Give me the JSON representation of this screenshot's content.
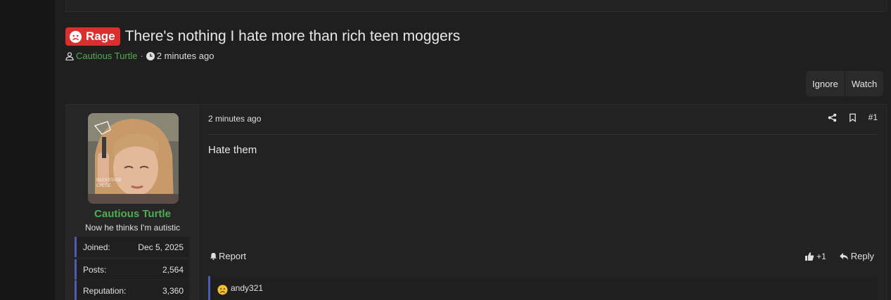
{
  "thread": {
    "prefix": "Rage",
    "title": "There's nothing I hate more than rich teen moggers",
    "author": "Cautious Turtle",
    "meta_separator": "·",
    "time": "2 minutes ago"
  },
  "thread_actions": {
    "ignore": "Ignore",
    "watch": "Watch"
  },
  "post": {
    "time": "2 minutes ago",
    "number": "#1",
    "body": "Hate them",
    "report": "Report",
    "reaction_count": "+1",
    "reply": "Reply",
    "reacted_by": "andy321"
  },
  "user": {
    "name": "Cautious Turtle",
    "title": "Now he thinks I'm autistic",
    "avatar_text": "BACKSTAGE CHLOE",
    "stats": [
      {
        "label": "Joined:",
        "value": "Dec 5, 2025"
      },
      {
        "label": "Posts:",
        "value": "2,564"
      },
      {
        "label": "Reputation:",
        "value": "3,360"
      }
    ]
  },
  "colors": {
    "prefix_bg": "#d9302f",
    "username": "#4fae4f",
    "stat_accent": "#4b5cb5"
  }
}
